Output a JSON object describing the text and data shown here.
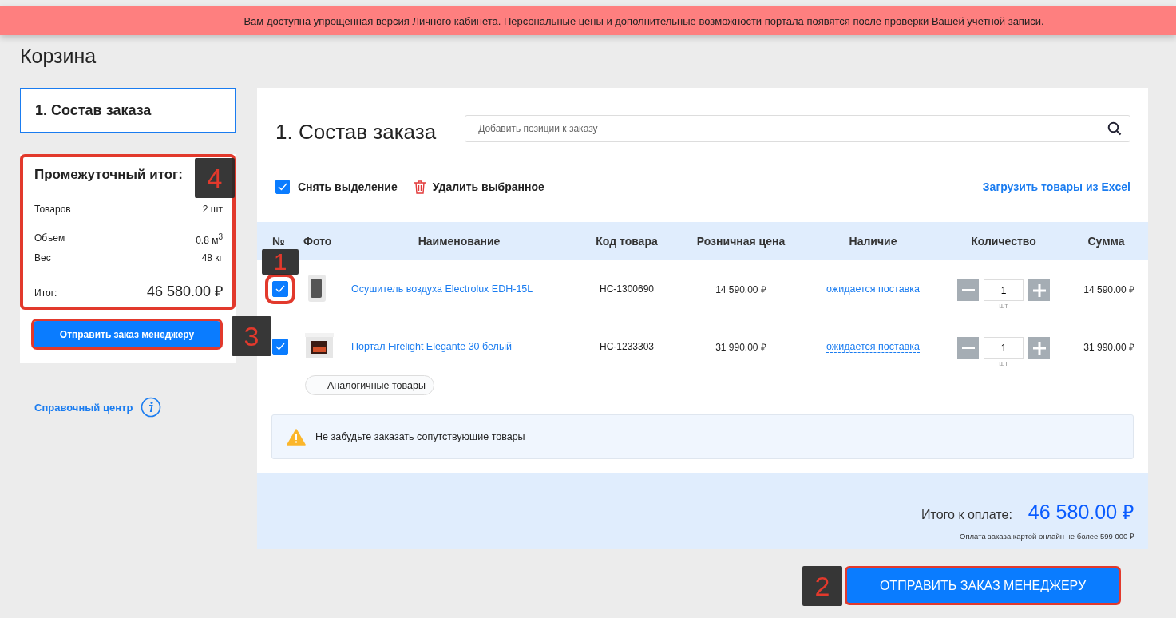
{
  "banner": {
    "text": "Вам доступна упрощенная версия Личного кабинета. Персональные цены и дополнительные возможности портала появятся после проверки Вашей учетной записи."
  },
  "page_title": "Корзина",
  "sidebar": {
    "step": {
      "label": "1. Состав заказа",
      "selected": true
    },
    "summary": {
      "title": "Промежуточный итог:",
      "annotation": "4",
      "groups": [
        {
          "rows": [
            {
              "label": "Товаров",
              "value": "2 шт"
            }
          ]
        },
        {
          "rows": [
            {
              "label": "Объем",
              "value": "0.8 м$^{3}$"
            },
            {
              "label": "Вес",
              "value": "48 кг"
            }
          ]
        }
      ],
      "total_label": "Итог:",
      "total_value": "46 580.00 ₽"
    },
    "button": {
      "label": "Отправить заказ менеджеру",
      "annotation": "3"
    },
    "help_link": "Справочный центр"
  },
  "main": {
    "title": "1. Состав заказа",
    "search": {
      "placeholder": "Добавить позиции к заказу"
    },
    "actions": {
      "select": {
        "label": "Снять выделение",
        "checked": true
      },
      "delete": "Удалить выбранное",
      "import": "Загрузить товары из Excel"
    },
    "table": {
      "columns": [
        "№",
        "Фото",
        "Наименование",
        "Код товара",
        "Розничная цена",
        "Наличие",
        "Количество",
        "Сумма"
      ],
      "rows": [
        {
          "checked": true,
          "annotation": "1",
          "kind": "dehumidifier",
          "name": "Осушитель воздуха Electrolux EDH-15L",
          "code": "HC-1300690",
          "price": "14 590.00 ₽",
          "availability": "ожидается поставка",
          "quantity": "1",
          "unit": "шт",
          "sum": "14 590.00 ₽"
        },
        {
          "checked": true,
          "kind": "fireplace",
          "name": "Портал Firelight Elegante 30 белый",
          "code": "HC-1233303",
          "price": "31 990.00 ₽",
          "availability": "ожидается поставка",
          "quantity": "1",
          "unit": "шт",
          "sum": "31 990.00 ₽"
        }
      ]
    },
    "analogs": "Аналогичные товары",
    "notice": "Не забудьте заказать сопутствующие товары",
    "totals": {
      "label": "Итого к оплате:",
      "value": "46 580.00 ₽",
      "note": "Оплата заказа картой онлайн не более 599 000 ₽"
    }
  },
  "submit": {
    "label": "ОТПРАВИТЬ ЗАКАЗ МЕНЕДЖЕРУ",
    "annotation": "2"
  }
}
